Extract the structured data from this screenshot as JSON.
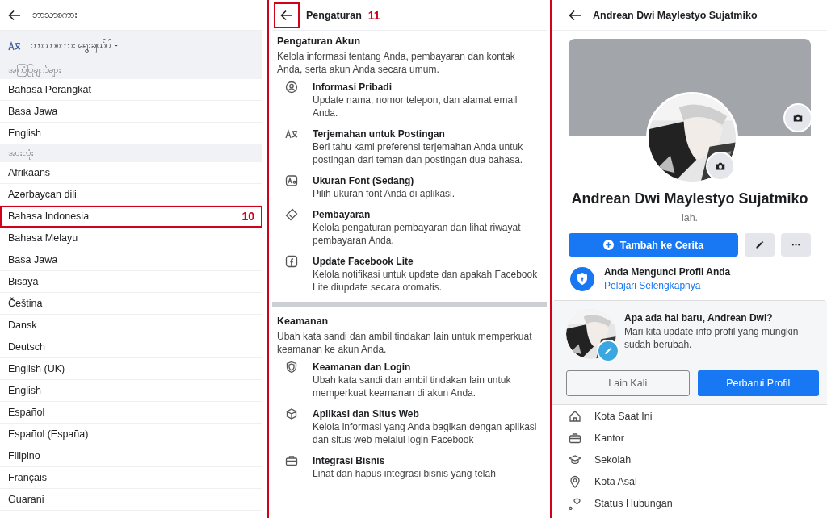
{
  "language_panel": {
    "title": "ဘာသာစကား",
    "picker": "ဘာသာစကား ရွေးချယ်ပါ -",
    "sections": [
      {
        "title": "အကြံပြုချက်များ",
        "items": [
          {
            "label": "Bahasa Perangkat"
          },
          {
            "label": "Basa Jawa"
          },
          {
            "label": "English"
          }
        ]
      },
      {
        "title": "အားလုံး",
        "items": [
          {
            "label": "Afrikaans"
          },
          {
            "label": "Azərbaycan dili"
          },
          {
            "label": "Bahasa Indonesia",
            "callout": "10"
          },
          {
            "label": "Bahasa Melayu"
          },
          {
            "label": "Basa Jawa"
          },
          {
            "label": "Bisaya"
          },
          {
            "label": "Čeština"
          },
          {
            "label": "Dansk"
          },
          {
            "label": "Deutsch"
          },
          {
            "label": "English (UK)"
          },
          {
            "label": "English"
          },
          {
            "label": "Español"
          },
          {
            "label": "Español (España)"
          },
          {
            "label": "Filipino"
          },
          {
            "label": "Français"
          },
          {
            "label": "Guarani"
          }
        ]
      }
    ]
  },
  "settings_panel": {
    "title": "Pengaturan",
    "back_callout": "11",
    "sections": [
      {
        "title": "Pengaturan Akun",
        "description": "Kelola informasi tentang Anda, pembayaran dan kontak Anda, serta akun Anda secara umum.",
        "items": [
          {
            "title": "Informasi Pribadi",
            "description": "Update nama, nomor telepon, dan alamat email Anda."
          },
          {
            "title": "Terjemahan untuk Postingan",
            "description": "Beri tahu kami preferensi terjemahan Anda untuk postingan dari teman dan postingan dua bahasa."
          },
          {
            "title": "Ukuran Font (Sedang)",
            "description": "Pilih ukuran font Anda di aplikasi."
          },
          {
            "title": "Pembayaran",
            "description": "Kelola pengaturan pembayaran dan lihat riwayat pembayaran Anda."
          },
          {
            "title": "Update Facebook Lite",
            "description": "Kelola notifikasi untuk update dan apakah Facebook Lite diupdate secara otomatis."
          }
        ]
      },
      {
        "title": "Keamanan",
        "description": "Ubah kata sandi dan ambil tindakan lain untuk memperkuat keamanan ke akun Anda.",
        "items": [
          {
            "title": "Keamanan dan Login",
            "description": "Ubah kata sandi dan ambil tindakan lain untuk memperkuat keamanan di akun Anda."
          },
          {
            "title": "Aplikasi dan Situs Web",
            "description": "Kelola informasi yang Anda bagikan dengan aplikasi dan situs web melalui login Facebook"
          },
          {
            "title": "Integrasi Bisnis",
            "description": "Lihat dan hapus integrasi bisnis yang telah"
          }
        ]
      }
    ]
  },
  "profile_panel": {
    "title": "Andrean Dwi Maylestyo Sujatmiko",
    "name": "Andrean Dwi Maylestyo Sujatmiko",
    "bio": "lah.",
    "add_story_button": "Tambah ke Cerita",
    "lock_notice": {
      "title": "Anda Mengunci Profil Anda",
      "link": "Pelajari Selengkapnya"
    },
    "update_card": {
      "title": "Apa ada hal baru, Andrean Dwi?",
      "text": "Mari kita update info profil yang mungkin sudah berubah.",
      "buttons": [
        "Lain Kali",
        "Perbarui Profil"
      ]
    },
    "details": [
      "Kota Saat Ini",
      "Kantor",
      "Sekolah",
      "Kota Asal",
      "Status Hubungan"
    ]
  }
}
